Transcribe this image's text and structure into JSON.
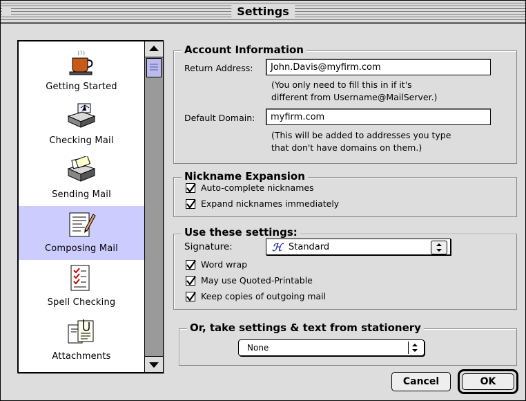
{
  "window": {
    "title": "Settings"
  },
  "sidebar": {
    "items": [
      {
        "label": "Getting Started",
        "icon": "coffee-cup-icon"
      },
      {
        "label": "Checking Mail",
        "icon": "inbox-tray-icon"
      },
      {
        "label": "Sending Mail",
        "icon": "outbox-tray-icon"
      },
      {
        "label": "Composing Mail",
        "icon": "compose-document-icon",
        "selected": true
      },
      {
        "label": "Spell Checking",
        "icon": "spell-check-document-icon"
      },
      {
        "label": "Attachments",
        "icon": "attachment-document-icon"
      }
    ]
  },
  "account": {
    "title": "Account Information",
    "return_label": "Return Address:",
    "return_value": "John.Davis@myfirm.com",
    "return_note1": "(You only need to fill this in if it's",
    "return_note2": "different from Username@MailServer.)",
    "domain_label": "Default Domain:",
    "domain_value": "myfirm.com",
    "domain_note1": "(This will be added to addresses you type",
    "domain_note2": "that don't have domains on them.)"
  },
  "nickname": {
    "title": "Nickname Expansion",
    "opt1": "Auto-complete nicknames",
    "opt2": "Expand nicknames immediately",
    "opt1_checked": true,
    "opt2_checked": true
  },
  "settings": {
    "title": "Use these settings:",
    "signature_label": "Signature:",
    "signature_value": "Standard",
    "signature_icon": "signature-icon",
    "opt1": "Word wrap",
    "opt2": "May use Quoted-Printable",
    "opt3": "Keep copies of outgoing mail"
  },
  "stationery": {
    "title": "Or, take settings & text from stationery",
    "value": "None"
  },
  "buttons": {
    "cancel": "Cancel",
    "ok": "OK"
  }
}
